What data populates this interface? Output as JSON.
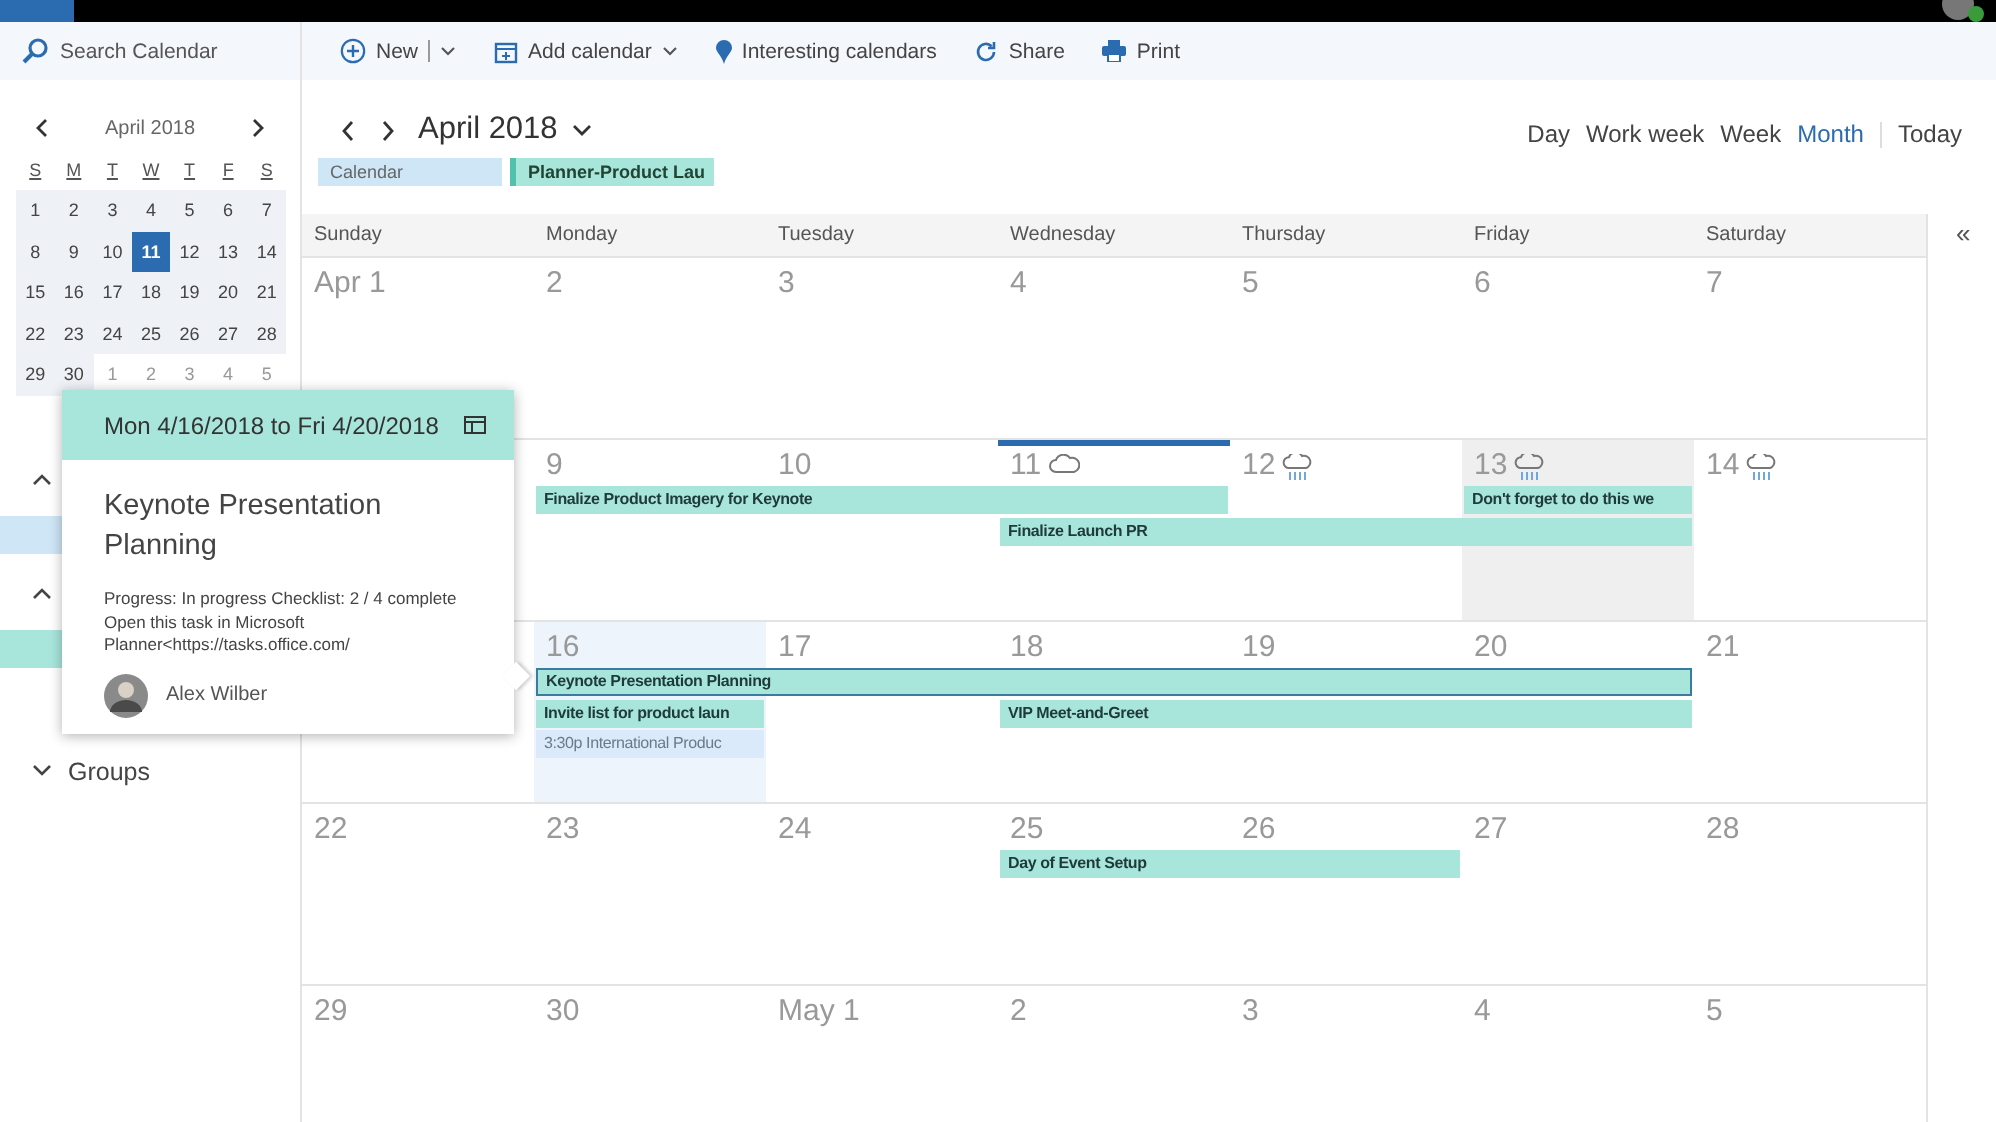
{
  "search": {
    "placeholder": "Search Calendar"
  },
  "toolbar": [
    {
      "label": "New"
    },
    {
      "label": "Add calendar"
    },
    {
      "label": "Interesting calendars"
    },
    {
      "label": "Share"
    },
    {
      "label": "Print"
    }
  ],
  "mini_calendar": {
    "title": "April 2018",
    "weekdays": [
      "S",
      "M",
      "T",
      "W",
      "T",
      "F",
      "S"
    ],
    "weeks": [
      [
        {
          "day": "1",
          "in_month": true,
          "selected": false
        },
        {
          "day": "2",
          "in_month": true,
          "selected": false
        },
        {
          "day": "3",
          "in_month": true,
          "selected": false
        },
        {
          "day": "4",
          "in_month": true,
          "selected": false
        },
        {
          "day": "5",
          "in_month": true,
          "selected": false
        },
        {
          "day": "6",
          "in_month": true,
          "selected": false
        },
        {
          "day": "7",
          "in_month": true,
          "selected": false
        }
      ],
      [
        {
          "day": "8",
          "in_month": true,
          "selected": false
        },
        {
          "day": "9",
          "in_month": true,
          "selected": false
        },
        {
          "day": "10",
          "in_month": true,
          "selected": false
        },
        {
          "day": "11",
          "in_month": true,
          "selected": true
        },
        {
          "day": "12",
          "in_month": true,
          "selected": false
        },
        {
          "day": "13",
          "in_month": true,
          "selected": false
        },
        {
          "day": "14",
          "in_month": true,
          "selected": false
        }
      ],
      [
        {
          "day": "15",
          "in_month": true,
          "selected": false
        },
        {
          "day": "16",
          "in_month": true,
          "selected": false
        },
        {
          "day": "17",
          "in_month": true,
          "selected": false
        },
        {
          "day": "18",
          "in_month": true,
          "selected": false
        },
        {
          "day": "19",
          "in_month": true,
          "selected": false
        },
        {
          "day": "20",
          "in_month": true,
          "selected": false
        },
        {
          "day": "21",
          "in_month": true,
          "selected": false
        }
      ],
      [
        {
          "day": "22",
          "in_month": true,
          "selected": false
        },
        {
          "day": "23",
          "in_month": true,
          "selected": false
        },
        {
          "day": "24",
          "in_month": true,
          "selected": false
        },
        {
          "day": "25",
          "in_month": true,
          "selected": false
        },
        {
          "day": "26",
          "in_month": true,
          "selected": false
        },
        {
          "day": "27",
          "in_month": true,
          "selected": false
        },
        {
          "day": "28",
          "in_month": true,
          "selected": false
        }
      ],
      [
        {
          "day": "29",
          "in_month": true,
          "selected": false
        },
        {
          "day": "30",
          "in_month": true,
          "selected": false
        },
        {
          "day": "1",
          "in_month": false,
          "selected": false
        },
        {
          "day": "2",
          "in_month": false,
          "selected": false
        },
        {
          "day": "3",
          "in_month": false,
          "selected": false
        },
        {
          "day": "4",
          "in_month": false,
          "selected": false
        },
        {
          "day": "5",
          "in_month": false,
          "selected": false
        }
      ]
    ]
  },
  "sidebar_sections": [
    {
      "expanded": true,
      "rows": [
        {
          "kind": "calendar"
        }
      ]
    },
    {
      "expanded": true,
      "rows": [
        {
          "kind": "planner"
        }
      ]
    },
    {
      "label": "Groups",
      "expanded": false
    }
  ],
  "header": {
    "title": "April 2018"
  },
  "legend": [
    {
      "label": "Calendar",
      "kind": "calendar"
    },
    {
      "label": "Planner-Product Lau",
      "kind": "planner"
    }
  ],
  "views": [
    {
      "label": "Day",
      "selected": false
    },
    {
      "label": "Work week",
      "selected": false
    },
    {
      "label": "Week",
      "selected": false
    },
    {
      "label": "Month",
      "selected": true
    }
  ],
  "today_button": "Today",
  "collapse_button": "«",
  "weekdays": [
    "Sunday",
    "Monday",
    "Tuesday",
    "Wednesday",
    "Thursday",
    "Friday",
    "Saturday"
  ],
  "weeks": [
    {
      "days": [
        {
          "label": "Apr 1",
          "today": false,
          "selected": false,
          "highlighted": false
        },
        {
          "label": "2",
          "today": false,
          "selected": false,
          "highlighted": false
        },
        {
          "label": "3",
          "today": false,
          "selected": false,
          "highlighted": false
        },
        {
          "label": "4",
          "today": false,
          "selected": false,
          "highlighted": false
        },
        {
          "label": "5",
          "today": false,
          "selected": false,
          "highlighted": false
        },
        {
          "label": "6",
          "today": false,
          "selected": false,
          "highlighted": false
        },
        {
          "label": "7",
          "today": false,
          "selected": false,
          "highlighted": false
        }
      ]
    },
    {
      "days": [
        {
          "label": "9",
          "today": false,
          "selected": false,
          "highlighted": false
        },
        {
          "label": "10",
          "today": false,
          "selected": false,
          "highlighted": false
        },
        {
          "label": "11",
          "today": true,
          "selected": false,
          "highlighted": false,
          "weather": {
            "kind": "cloud"
          }
        },
        {
          "label": "12",
          "today": false,
          "selected": false,
          "highlighted": false,
          "weather": {
            "kind": "rain"
          }
        },
        {
          "label": "13",
          "today": false,
          "selected": true,
          "highlighted": false,
          "weather": {
            "kind": "rain"
          }
        },
        {
          "label": "14",
          "today": false,
          "selected": false,
          "highlighted": false,
          "weather": {
            "kind": "rain"
          }
        }
      ],
      "event_rows": [
        [
          {
            "kind": "free"
          },
          {
            "kind": "planner",
            "title": "Finalize Product Imagery for Keynote",
            "selected": false
          },
          {
            "kind": "continued"
          },
          {
            "kind": "continued"
          },
          {
            "kind": "free"
          },
          {
            "kind": "planner",
            "title": "Don't forget to do this we",
            "selected": false
          },
          {
            "kind": "free"
          }
        ],
        [
          {
            "kind": "free"
          },
          {
            "kind": "free"
          },
          {
            "kind": "free"
          },
          {
            "kind": "planner",
            "title": "Finalize Launch PR",
            "selected": false
          },
          {
            "kind": "continued"
          },
          {
            "kind": "continued"
          },
          {
            "kind": "free"
          }
        ]
      ]
    },
    {
      "days": [
        {
          "label": "16",
          "today": false,
          "selected": false,
          "highlighted": true
        },
        {
          "label": "17",
          "today": false,
          "selected": false,
          "highlighted": false
        },
        {
          "label": "18",
          "today": false,
          "selected": false,
          "highlighted": false
        },
        {
          "label": "19",
          "today": false,
          "selected": false,
          "highlighted": false
        },
        {
          "label": "20",
          "today": false,
          "selected": false,
          "highlighted": false
        },
        {
          "label": "21",
          "today": false,
          "selected": false,
          "highlighted": false
        }
      ],
      "event_rows": [
        [
          {
            "kind": "free"
          },
          {
            "kind": "planner",
            "title": "Keynote Presentation Planning",
            "selected": true
          },
          {
            "kind": "continued"
          },
          {
            "kind": "continued"
          },
          {
            "kind": "continued"
          },
          {
            "kind": "continued"
          },
          {
            "kind": "free"
          }
        ],
        [
          {
            "kind": "free"
          },
          {
            "kind": "planner",
            "title": "Invite list for product laun",
            "selected": false
          },
          {
            "kind": "free"
          },
          {
            "kind": "planner",
            "title": "VIP Meet-and-Greet",
            "selected": false
          },
          {
            "kind": "continued"
          },
          {
            "kind": "continued"
          },
          {
            "kind": "free"
          }
        ],
        [
          {
            "kind": "free"
          },
          {
            "kind": "calendar",
            "title": "3:30p International Produc",
            "selected": false
          },
          {
            "kind": "free"
          },
          {
            "kind": "free"
          },
          {
            "kind": "free"
          },
          {
            "kind": "free"
          },
          {
            "kind": "free"
          }
        ]
      ]
    },
    {
      "days": [
        {
          "label": "22",
          "today": false,
          "selected": false,
          "highlighted": false
        },
        {
          "label": "23",
          "today": false,
          "selected": false,
          "highlighted": false
        },
        {
          "label": "24",
          "today": false,
          "selected": false,
          "highlighted": false
        },
        {
          "label": "25",
          "today": false,
          "selected": false,
          "highlighted": false
        },
        {
          "label": "26",
          "today": false,
          "selected": false,
          "highlighted": false
        },
        {
          "label": "27",
          "today": false,
          "selected": false,
          "highlighted": false
        },
        {
          "label": "28",
          "today": false,
          "selected": false,
          "highlighted": false
        }
      ],
      "event_rows": [
        [
          {
            "kind": "free"
          },
          {
            "kind": "free"
          },
          {
            "kind": "free"
          },
          {
            "kind": "planner",
            "title": "Day of Event Setup",
            "selected": false
          },
          {
            "kind": "continued"
          },
          {
            "kind": "free"
          },
          {
            "kind": "free"
          }
        ]
      ]
    },
    {
      "days": [
        {
          "label": "29",
          "today": false,
          "selected": false,
          "highlighted": false
        },
        {
          "label": "30",
          "today": false,
          "selected": false,
          "highlighted": false
        },
        {
          "label": "May 1",
          "today": false,
          "selected": false,
          "highlighted": false
        },
        {
          "label": "2",
          "today": false,
          "selected": false,
          "highlighted": false
        },
        {
          "label": "3",
          "today": false,
          "selected": false,
          "highlighted": false
        },
        {
          "label": "4",
          "today": false,
          "selected": false,
          "highlighted": false
        },
        {
          "label": "5",
          "today": false,
          "selected": false,
          "highlighted": false
        }
      ]
    }
  ],
  "popup": {
    "date_range": "Mon 4/16/2018 to Fri 4/20/2018",
    "title": "Keynote Presentation Planning",
    "details": "Progress: In progress Checklist: 2 / 4 complete Open this task in Microsoft Planner<https://tasks.office.com/",
    "owner": "Alex Wilber"
  }
}
